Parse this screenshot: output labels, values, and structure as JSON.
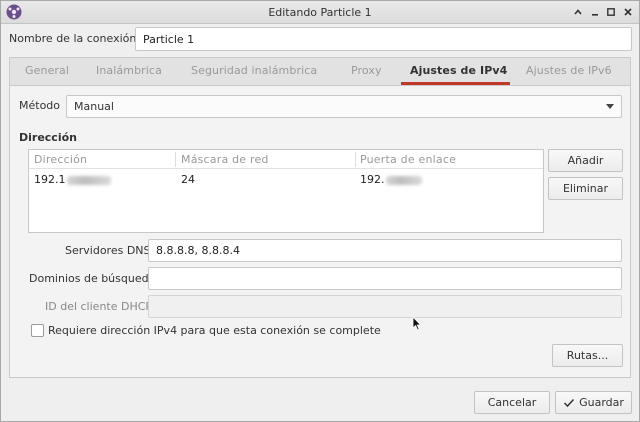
{
  "window": {
    "title": "Editando Particle 1",
    "controls": {
      "minimize": "–",
      "maximize": "◻",
      "restore": "◂"
    }
  },
  "connection": {
    "label": "Nombre de la conexión",
    "value": "Particle 1"
  },
  "tabs": [
    {
      "label": "General",
      "active": false
    },
    {
      "label": "Inalámbrica",
      "active": false
    },
    {
      "label": "Seguridad inalámbrica",
      "active": false
    },
    {
      "label": "Proxy",
      "active": false
    },
    {
      "label": "Ajustes de IPv4",
      "active": true
    },
    {
      "label": "Ajustes de IPv6",
      "active": false
    }
  ],
  "ipv4": {
    "method_label": "Método",
    "method_value": "Manual",
    "addresses_title": "Dirección",
    "table": {
      "headers": [
        "Dirección",
        "Máscara de red",
        "Puerta de enlace"
      ],
      "rows": [
        {
          "address": "192.1",
          "netmask": "24",
          "gateway": "192."
        }
      ]
    },
    "add_button": "Añadir",
    "delete_button": "Eliminar",
    "dns_label": "Servidores DNS",
    "dns_value": "8.8.8.8, 8.8.8.4",
    "search_label": "Dominios de búsqueda",
    "search_value": "",
    "dhcp_label": "ID del cliente DHCP",
    "dhcp_value": "",
    "require_checkbox_label": "Requiere dirección IPv4 para que esta conexión se complete",
    "require_checked": false,
    "routes_button": "Rutas..."
  },
  "footer": {
    "cancel_button": "Cancelar",
    "save_button": "Guardar"
  },
  "colors": {
    "accent": "#c0392b",
    "window_bg": "#efefef"
  }
}
